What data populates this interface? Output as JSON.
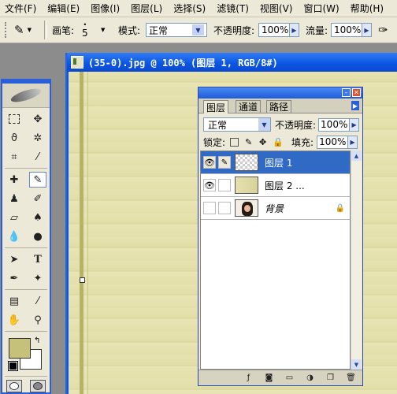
{
  "menubar": {
    "items": [
      "文件(F)",
      "编辑(E)",
      "图像(I)",
      "图层(L)",
      "选择(S)",
      "滤镜(T)",
      "视图(V)",
      "窗口(W)",
      "帮助(H)"
    ]
  },
  "options": {
    "brush_label": "画笔:",
    "brush_size": "5",
    "mode_label": "模式:",
    "mode_value": "正常",
    "opacity_label": "不透明度:",
    "opacity_value": "100%",
    "flow_label": "流量:",
    "flow_value": "100%"
  },
  "document": {
    "title": "(35-0).jpg @ 100% (图层 1, RGB/8#)"
  },
  "layers_panel": {
    "tabs": [
      "图层",
      "通道",
      "路径"
    ],
    "blend_mode": "正常",
    "opacity_label": "不透明度:",
    "opacity_value": "100%",
    "lock_label": "锁定:",
    "fill_label": "填充:",
    "fill_value": "100%",
    "layers": [
      {
        "name": "图层 1",
        "visible": true,
        "selected": true
      },
      {
        "name": "图层 2 ...",
        "visible": true,
        "selected": false
      },
      {
        "name": "背景",
        "visible": false,
        "selected": false,
        "locked": true
      }
    ]
  },
  "colors": {
    "foreground": "#c5c17a",
    "background": "#ffffff",
    "selection": "#316ac5",
    "titlebar": "#0a56e8"
  }
}
